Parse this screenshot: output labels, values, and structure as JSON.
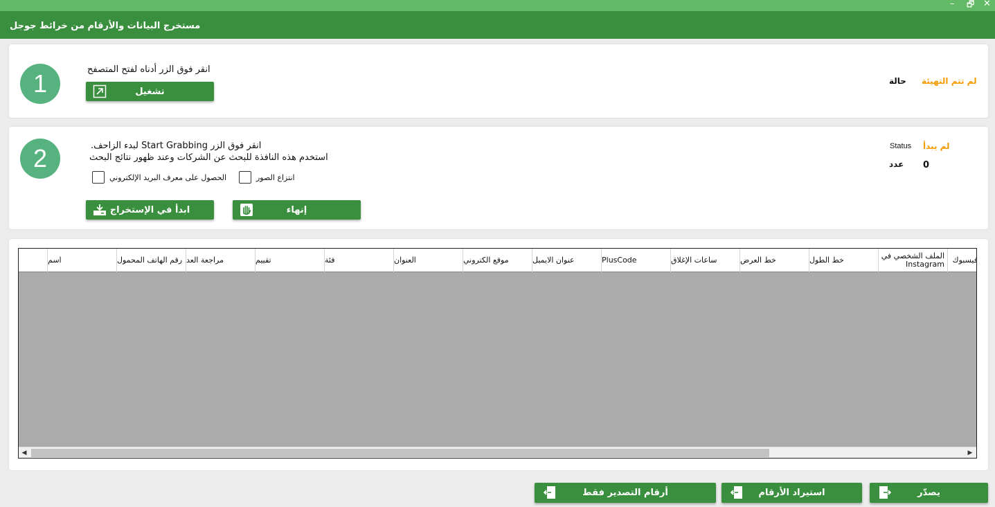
{
  "window": {
    "title": "مستخرج البيانات والأرقام من خرائط جوجل",
    "minimize": "–",
    "restore": "🗗",
    "close": "✕"
  },
  "step1": {
    "number": "1",
    "instruction": "انقر فوق الزر أدناه لفتح المتصفح",
    "run_label": "تشغيل",
    "run_icon": "open-external-icon",
    "status_label": "حالة",
    "status_value": "لم تتم التهيئة"
  },
  "step2": {
    "number": "2",
    "line1": "انقر فوق الزر Start Grabbing لبدء الزاحف.",
    "line2": "استخدم هذه النافذة للبحث عن الشركات وعند ظهور نتائج البحث",
    "email_option": "الحصول على معرف البريد الإلكتروني",
    "images_option": "انتزاع الصور",
    "start_label": "ابدأ في الإستخراج",
    "stop_label": "إنهاء",
    "status_label": "Status",
    "status_value": "لم يبدأ",
    "count_label": "عدد",
    "count_value": "0"
  },
  "table": {
    "columns": [
      "اسم",
      "رقم الهاتف المحمول",
      "مراجعة العد",
      "تقييم",
      "فئة",
      "العنوان",
      "موقع الكتروني",
      "عنوان الايميل",
      "PlusCode",
      "ساعات الإغلاق",
      "خط العرض",
      "خط الطول",
      "الملف الشخصي في Instagram",
      "فيسبوك"
    ],
    "scroll_left": "◀",
    "scroll_right": "▶"
  },
  "footer": {
    "export_label": "يصدّر",
    "import_label": "استيراد الأرقام",
    "export_numbers_label": "أرقام التصدير فقط"
  },
  "colors": {
    "title_bar": "#62b966",
    "header": "#3a8f3e",
    "button": "#3a8f3e",
    "circle": "#56b37f",
    "status_orange": "#f59a00"
  }
}
